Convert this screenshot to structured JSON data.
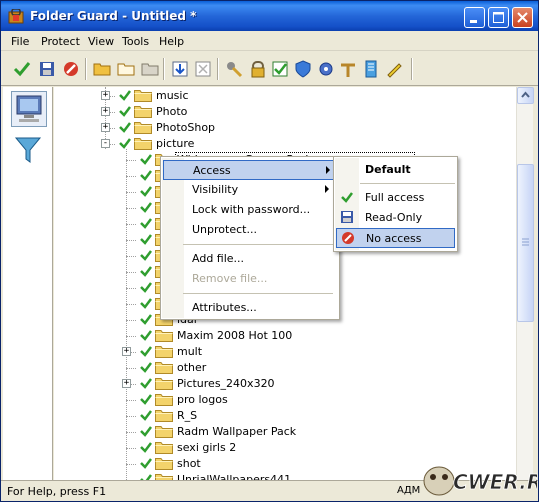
{
  "window": {
    "title": "Folder Guard - Untitled *"
  },
  "menubar": {
    "items": [
      "File",
      "Protect",
      "View",
      "Tools",
      "Help"
    ]
  },
  "toolbar": {
    "icons": [
      "check-icon",
      "save-icon",
      "stop-icon",
      "folder-icon",
      "folder-open-icon",
      "folder-gray-icon",
      "import-icon",
      "export-icon",
      "tools-icon",
      "lock-icon",
      "checkmark-box-icon",
      "shield-icon",
      "gear-icon",
      "key-icon",
      "book-icon",
      "pencil-icon"
    ]
  },
  "left_panel": {
    "buttons": [
      "computer-icon",
      "filter-icon"
    ]
  },
  "tree": {
    "items": [
      {
        "label": "music",
        "expander": "+",
        "indent": 0
      },
      {
        "label": "Photo",
        "expander": "+",
        "indent": 0
      },
      {
        "label": "PhotoShop",
        "expander": "+",
        "indent": 0
      },
      {
        "label": "picture",
        "expander": "-",
        "indent": 0
      },
      {
        "label": "Widescreen Games Pack",
        "expander": "",
        "indent": 1
      },
      {
        "label": "",
        "expander": "",
        "indent": 1
      },
      {
        "label": "",
        "expander": "",
        "indent": 1
      },
      {
        "label": "",
        "expander": "",
        "indent": 1
      },
      {
        "label": "",
        "expander": "",
        "indent": 1
      },
      {
        "label": "",
        "expander": "",
        "indent": 1
      },
      {
        "label": ") (1600x1200)",
        "expander": "",
        "indent": 1
      },
      {
        "label": "",
        "expander": "",
        "indent": 1
      },
      {
        "label": "",
        "expander": "",
        "indent": 1
      },
      {
        "label": "",
        "expander": "",
        "indent": 1
      },
      {
        "label": "ldal",
        "expander": "",
        "indent": 1
      },
      {
        "label": "Maxim 2008 Hot 100",
        "expander": "",
        "indent": 1
      },
      {
        "label": "mult",
        "expander": "+",
        "indent": 1
      },
      {
        "label": "other",
        "expander": "",
        "indent": 1
      },
      {
        "label": "Pictures_240x320",
        "expander": "+",
        "indent": 1
      },
      {
        "label": "pro logos",
        "expander": "",
        "indent": 1
      },
      {
        "label": "R_S",
        "expander": "",
        "indent": 1
      },
      {
        "label": "Radm Wallpaper Pack",
        "expander": "",
        "indent": 1
      },
      {
        "label": "sexi girls 2",
        "expander": "",
        "indent": 1
      },
      {
        "label": "shot",
        "expander": "",
        "indent": 1
      },
      {
        "label": "UnrialWallpapers441",
        "expander": "",
        "indent": 1
      }
    ]
  },
  "context_menu": {
    "items": [
      {
        "label": "Access",
        "submenu": true,
        "highlighted": true,
        "disabled": false
      },
      {
        "label": "Visibility",
        "submenu": true,
        "highlighted": false,
        "disabled": false
      },
      {
        "label": "Lock with password...",
        "submenu": false,
        "highlighted": false,
        "disabled": false
      },
      {
        "label": "Unprotect...",
        "submenu": false,
        "highlighted": false,
        "disabled": false
      },
      {
        "separator": true
      },
      {
        "label": "Add file...",
        "submenu": false,
        "highlighted": false,
        "disabled": false
      },
      {
        "label": "Remove file...",
        "submenu": false,
        "highlighted": false,
        "disabled": true
      },
      {
        "separator": true
      },
      {
        "label": "Attributes...",
        "submenu": false,
        "highlighted": false,
        "disabled": false
      }
    ]
  },
  "access_submenu": {
    "items": [
      {
        "label": "Default",
        "icon": "",
        "bold": true,
        "highlighted": false
      },
      {
        "separator": true
      },
      {
        "label": "Full access",
        "icon": "green-check-icon",
        "bold": false,
        "highlighted": false
      },
      {
        "label": "Read-Only",
        "icon": "floppy-read-only-icon",
        "bold": false,
        "highlighted": false
      },
      {
        "label": "No access",
        "icon": "no-access-icon",
        "bold": false,
        "highlighted": true
      }
    ]
  },
  "statusbar": {
    "help_text": "For Help, press F1",
    "right_text": "АДМ"
  },
  "watermark": {
    "text": "CWER.RU"
  },
  "colors": {
    "title_bar": "#1450c8",
    "menu_highlight": "#c1d2ee",
    "check_green": "#2f9e2f",
    "folder_yellow": "#f3d36b"
  }
}
